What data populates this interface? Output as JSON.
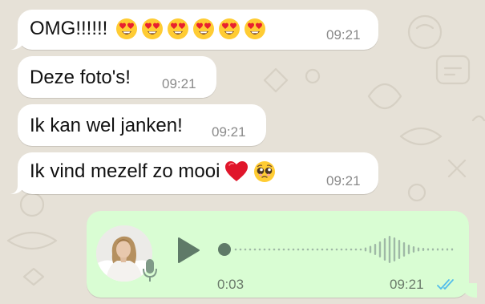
{
  "messages": [
    {
      "text": "OMG!!!!!!",
      "emoji_count": 6,
      "emoji": "heart-eyes-emoji",
      "time": "09:21"
    },
    {
      "text": "Deze foto's!",
      "time": "09:21"
    },
    {
      "text": "Ik kan wel janken!",
      "time": "09:21"
    },
    {
      "text": "Ik vind mezelf zo mooi",
      "emojis": [
        "red-heart-emoji",
        "pleading-face-emoji"
      ],
      "time": "09:21"
    }
  ],
  "voice_message": {
    "duration": "0:03",
    "time": "09:21",
    "status_icon": "double-check-icon",
    "status": "read",
    "progress": 0
  },
  "colors": {
    "background": "#e6e1d7",
    "incoming_bubble": "#ffffff",
    "outgoing_bubble": "#d9fdd3",
    "read_ticks": "#53bdeb",
    "play_button": "#5f7a68"
  }
}
